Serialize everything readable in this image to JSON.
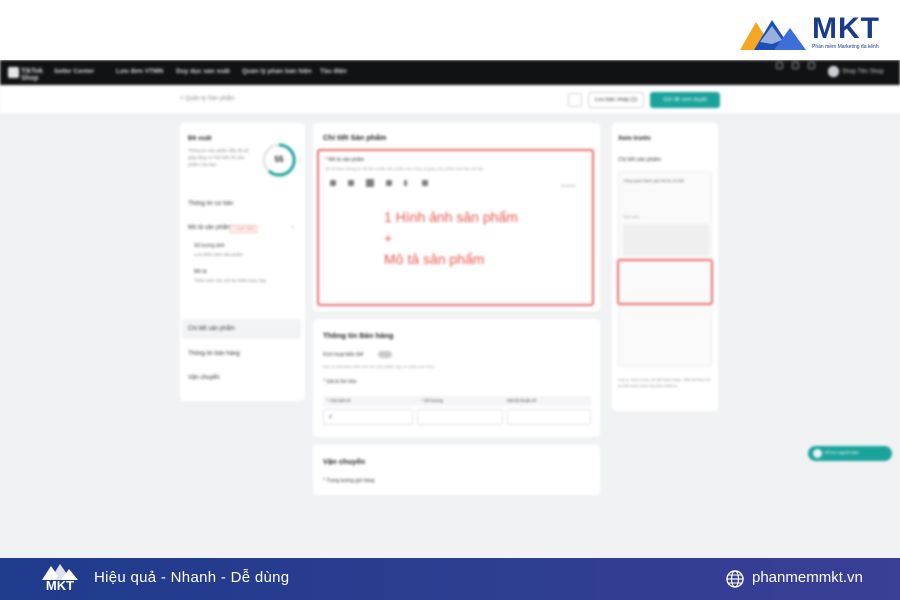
{
  "brand": {
    "name": "MKT",
    "tagline": "Phần mềm Marketing đa kênh",
    "colors": {
      "blue": "#1a3b8c",
      "orange": "#f5a623",
      "teal": "#1aa39a",
      "highlight": "#e86a6a"
    }
  },
  "topnav": {
    "logo_word": "TikTok Shop",
    "items": [
      "Seller Center",
      "Lưu đơn VTMN",
      "Duy dục sản xuất",
      "Quản lý phản bản hiện",
      "Tàu điện"
    ],
    "shop_name": "Shop Tên Shop"
  },
  "subbar": {
    "breadcrumb": "< Quản lý Sản phẩm",
    "save_draft": "Lưu bản nháp (1)",
    "submit": "Gửi đề xem duyệt"
  },
  "left_panel": {
    "title": "Đề xuất",
    "description": "Thông tin sản phẩm đầy đủ sẽ giúp tăng cơ hội hiển thị sản phẩm của bạn",
    "score": "55",
    "items": {
      "basic_info": "Thông tin cơ bản",
      "product_details": "Mô tả sản phẩm",
      "product_details_badge": "1 lượt sửa",
      "sub1_title": "Số lượng ảnh",
      "sub1_desc": "Lưu thêm ảnh sản phẩm",
      "sub2_title": "Mô tả",
      "sub2_desc": "Thêm ảnh vào mô tả chiến lược hay",
      "detail_product": "Chi tiết sản phẩm",
      "sales_info": "Thông tin bán hàng",
      "shipping": "Vận chuyển"
    }
  },
  "center": {
    "details_card": {
      "title": "Chi tiết Sản phẩm",
      "field_label": "* Mô tả sản phẩm",
      "field_hint": "Mô tả thêm thông tin để đạt chuẩn sản phẩm bán chạy và giúp sản phẩm của bạn nổi bật",
      "counter": "0/10000",
      "annotation_line1": "1 Hình ảnh sản phẩm",
      "annotation_plus": "+",
      "annotation_line2": "Mô tả sản phẩm"
    },
    "sales_card": {
      "title": "Thông tin Bán hàng",
      "toggle_label": "Kích hoạt biến thể",
      "toggle_hint": "Bạn có thể thêm biến thể nếu sản phẩm này có nhiều lựa chọn",
      "section_label": "* Giá & tồn kho",
      "columns": [
        "* Giá bán lẻ",
        "* Số lượng",
        "Mã kỹ thuật số"
      ],
      "first_cell": "đ"
    },
    "shipping_card": {
      "title": "Vận chuyển",
      "field_label": "* Trọng lượng gói hàng"
    }
  },
  "right_panel": {
    "title": "Xem trước",
    "subtitle": "Chi tiết sản phẩm",
    "tabs": "Tổng quan   Đánh giá   Mô tả   Chi tiết",
    "img_label": "Hình ảnh",
    "footer_note": "Lưu ý: Xem trước chỉ để tham khảo, hiển thị thực tế có thể khác nhau tùy theo thiết bị."
  },
  "help": {
    "label": "Hỗ trợ người bán"
  },
  "footer": {
    "logo_word": "MKT",
    "slogan": "Hiệu quả - Nhanh - Dễ dùng",
    "site": "phanmemmkt.vn"
  }
}
